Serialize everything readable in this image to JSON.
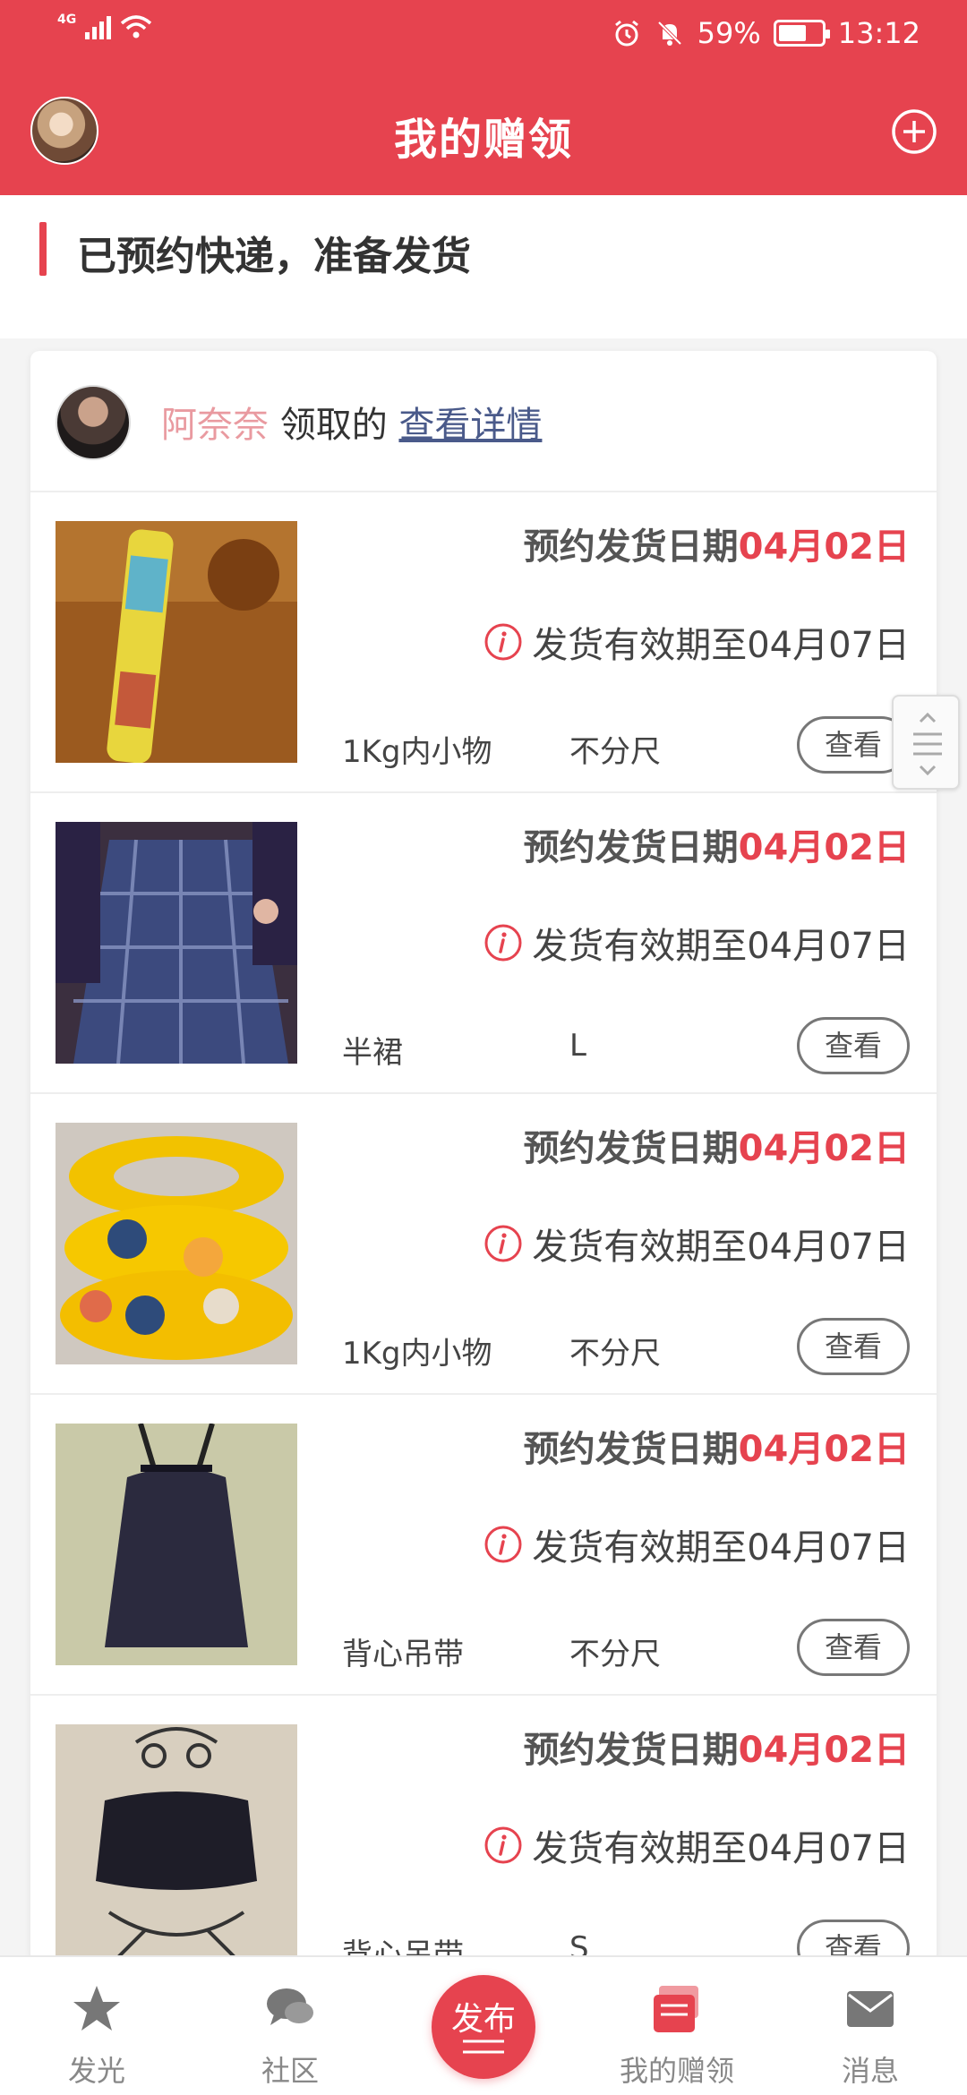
{
  "status": {
    "network": "4G",
    "battery": "59%",
    "time": "13:12"
  },
  "header": {
    "title": "我的赠领"
  },
  "section": {
    "title": "已预约快递，准备发货"
  },
  "card": {
    "user_name": "阿奈奈",
    "claim_text": "领取的",
    "detail_link": "查看详情",
    "items": [
      {
        "date_label": "预约发货日期",
        "date_value": "04月02日",
        "valid_text": "发货有效期至04月07日",
        "category": "1Kg内小物",
        "size": "不分尺",
        "button": "查看"
      },
      {
        "date_label": "预约发货日期",
        "date_value": "04月02日",
        "valid_text": "发货有效期至04月07日",
        "category": "半裙",
        "size": "L",
        "button": "查看"
      },
      {
        "date_label": "预约发货日期",
        "date_value": "04月02日",
        "valid_text": "发货有效期至04月07日",
        "category": "1Kg内小物",
        "size": "不分尺",
        "button": "查看"
      },
      {
        "date_label": "预约发货日期",
        "date_value": "04月02日",
        "valid_text": "发货有效期至04月07日",
        "category": "背心吊带",
        "size": "不分尺",
        "button": "查看"
      },
      {
        "date_label": "预约发货日期",
        "date_value": "04月02日",
        "valid_text": "发货有效期至04月07日",
        "category": "背心吊带",
        "size": "S",
        "button": "查看"
      }
    ]
  },
  "tabs": {
    "faguang": "发光",
    "shequ": "社区",
    "publish": "发布",
    "my_gifts": "我的赠领",
    "messages": "消息"
  },
  "colors": {
    "brand": "#e6434f",
    "link": "#4a5a8a",
    "username": "#e99aa0"
  }
}
